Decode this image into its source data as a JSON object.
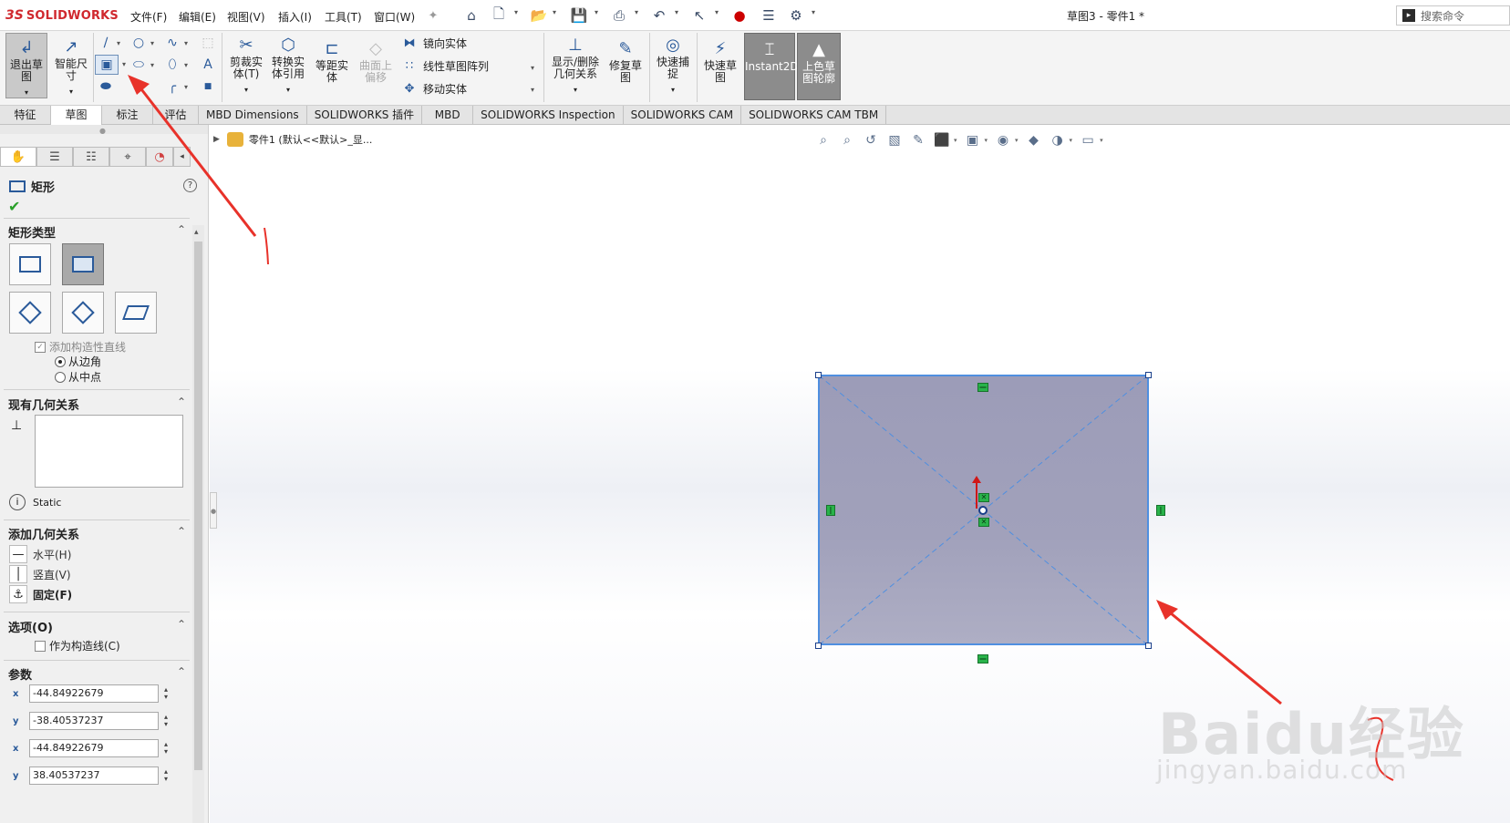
{
  "app": {
    "logo_ds": "3S",
    "logo_brand": "SOLIDWORKS",
    "document_title": "草图3 - 零件1 *"
  },
  "menu": [
    {
      "label": "文件(F)"
    },
    {
      "label": "编辑(E)"
    },
    {
      "label": "视图(V)"
    },
    {
      "label": "插入(I)"
    },
    {
      "label": "工具(T)"
    },
    {
      "label": "窗口(W)"
    }
  ],
  "search": {
    "placeholder": "搜索命令"
  },
  "ribbon": {
    "exit_sketch": "退出草图",
    "smart_dim": "智能尺寸",
    "trim": "剪裁实体(T)",
    "convert": "转换实体引用",
    "offset": "等距实体",
    "surface_offset": "曲面上偏移",
    "mirror": "镜向实体",
    "linear_pattern": "线性草图阵列",
    "move": "移动实体",
    "display_relations": "显示/删除几何关系",
    "repair": "修复草图",
    "quick_snap": "快速捕捉",
    "rapid_sketch": "快速草图",
    "instant2d": "Instant2D",
    "shaded": "上色草图轮廓"
  },
  "tabs": [
    {
      "label": "特征",
      "active": false
    },
    {
      "label": "草图",
      "active": true
    },
    {
      "label": "标注",
      "active": false
    },
    {
      "label": "评估",
      "active": false
    },
    {
      "label": "MBD Dimensions",
      "active": false
    },
    {
      "label": "SOLIDWORKS 插件",
      "active": false
    },
    {
      "label": "MBD",
      "active": false
    },
    {
      "label": "SOLIDWORKS Inspection",
      "active": false
    },
    {
      "label": "SOLIDWORKS CAM",
      "active": false
    },
    {
      "label": "SOLIDWORKS CAM TBM",
      "active": false
    }
  ],
  "property_manager": {
    "title": "矩形",
    "help": "?",
    "rect_type_header": "矩形类型",
    "add_construction": "添加构造性直线",
    "from_corner": "从边角",
    "from_midpoint": "从中点",
    "existing_rel_header": "现有几何关系",
    "static": "Static",
    "add_rel_header": "添加几何关系",
    "rel_horizontal": "水平(H)",
    "rel_vertical": "竖直(V)",
    "rel_fix": "固定(F)",
    "options_header": "选项(O)",
    "as_construction": "作为构造线(C)",
    "params_header": "参数",
    "params": [
      {
        "icon": "x",
        "value": "-44.84922679"
      },
      {
        "icon": "y",
        "value": "-38.40537237"
      },
      {
        "icon": "x",
        "value": "-44.84922679"
      },
      {
        "icon": "y",
        "value": "38.40537237"
      }
    ]
  },
  "graphics": {
    "tree_item": "零件1 (默认<<默认>_显..."
  },
  "watermark": {
    "brand": "Baidu",
    "cn": "经验",
    "url": "jingyan.baidu.com"
  },
  "annotations": {
    "mark1": "1",
    "mark2": "2"
  }
}
